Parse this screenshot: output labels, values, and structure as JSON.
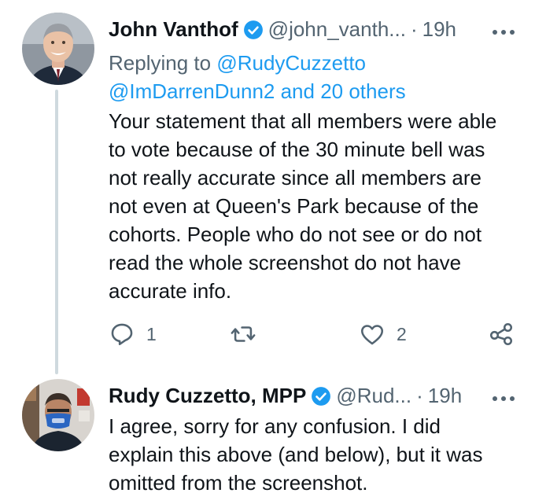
{
  "tweets": [
    {
      "author_name": "John Vanthof",
      "handle": "@john_vanth...",
      "separator": "·",
      "time": "19h",
      "reply_prefix": "Replying to",
      "reply_line1": "@RudyCuzzetto",
      "reply_line2": "@ImDarrenDunn2 and 20 others",
      "text": "Your statement that all members were able\nto vote because of the 30 minute bell was\nnot really accurate since all members are\nnot even at Queen's Park because of the\ncohorts.  People who do not see or do not\nread the whole screenshot do not have\naccurate info.",
      "reply_count": "1",
      "like_count": "2"
    },
    {
      "author_name": "Rudy Cuzzetto, MPP",
      "handle": "@Rud...",
      "separator": "·",
      "time": "19h",
      "text": "I agree, sorry for any confusion. I did\nexplain this above (and below), but it was\nomitted from the screenshot."
    }
  ],
  "colors": {
    "link": "#1d9bf0",
    "verified": "#1d9bf0",
    "secondary_text": "#536471",
    "thread_line": "#cfd9de"
  },
  "icons": [
    "verified-badge-icon",
    "more-icon",
    "reply-icon",
    "retweet-icon",
    "like-icon",
    "share-icon"
  ]
}
